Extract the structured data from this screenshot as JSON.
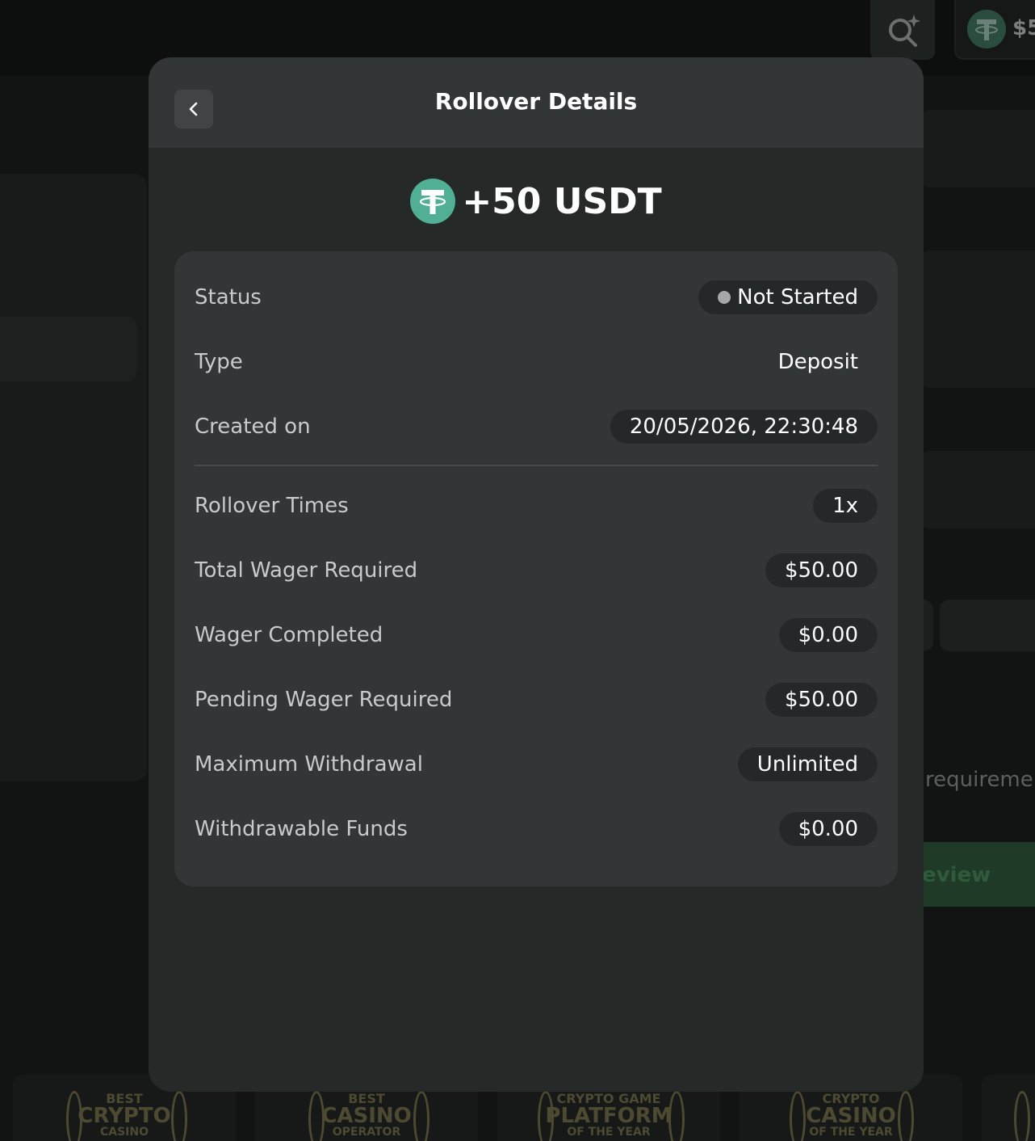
{
  "background": {
    "balance_amount": "$5",
    "bg_text_requirement": "requiremen",
    "bg_button_review": "eview",
    "awards": [
      {
        "line1": "BEST",
        "line2": "CRYPTO",
        "line3": "CASINO"
      },
      {
        "line1": "BEST",
        "line2": "CASINO",
        "line3": "OPERATOR"
      },
      {
        "line1": "CRYPTO GAME",
        "line2": "PLATFORM",
        "line3": "OF THE YEAR"
      },
      {
        "line1": "CRYPTO",
        "line2": "CASINO",
        "line3": "OF THE YEAR"
      }
    ]
  },
  "modal": {
    "title": "Rollover Details",
    "amount": "+50 USDT",
    "rows": [
      {
        "label": "Status",
        "value": "Not Started"
      },
      {
        "label": "Type",
        "value": "Deposit"
      },
      {
        "label": "Created on",
        "value": "20/05/2026, 22:30:48"
      },
      {
        "label": "Rollover Times",
        "value": "1x"
      },
      {
        "label": "Total Wager Required",
        "value": "$50.00"
      },
      {
        "label": "Wager Completed",
        "value": "$0.00"
      },
      {
        "label": "Pending Wager Required",
        "value": "$50.00"
      },
      {
        "label": "Maximum Withdrawal",
        "value": "Unlimited"
      },
      {
        "label": "Withdrawable Funds",
        "value": "$0.00"
      }
    ]
  },
  "colors": {
    "modal_bg": "#252928",
    "card_bg": "#323636",
    "pill_bg": "#242828",
    "tether_green": "#50af95",
    "status_dot": "#a4a8a7"
  },
  "icons": {
    "back": "chevron-left-icon",
    "currency": "tether-icon",
    "search": "search-sparkle-icon"
  }
}
